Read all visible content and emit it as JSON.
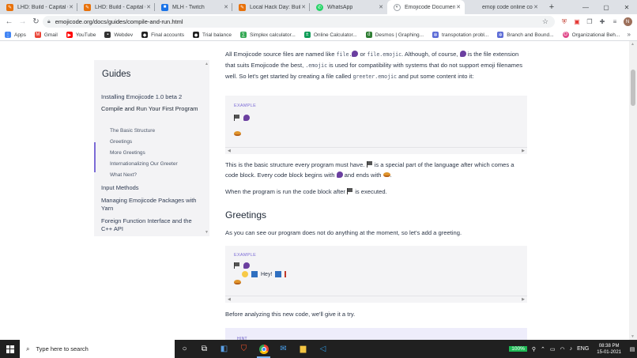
{
  "browser": {
    "tabs": [
      {
        "label": "LHD: Build - Capital One",
        "fav_color": "#e8710a",
        "active": false
      },
      {
        "label": "LHD: Build - Capital One",
        "fav_color": "#e8710a",
        "active": false
      },
      {
        "label": "MLH - Twitch",
        "fav_color": "#1a73e8",
        "active": false
      },
      {
        "label": "Local Hack Day: Build",
        "fav_color": "#e8710a",
        "active": false
      },
      {
        "label": "WhatsApp",
        "fav_color": "#25d366",
        "active": false
      },
      {
        "label": "Emojicode Documentation",
        "fav_color": "#5f6368",
        "active": true
      },
      {
        "label": "emoji code online compiler",
        "fav_color": "#ffffff",
        "active": false
      }
    ],
    "new_tab": "+",
    "window_controls": [
      "—",
      "▢",
      "✕"
    ],
    "url": "emojicode.org/docs/guides/compile-and-run.html",
    "profile_initial": "N"
  },
  "bookmarks": [
    {
      "label": "Apps",
      "color": "#4285f4"
    },
    {
      "label": "Gmail",
      "color": "#ea4335"
    },
    {
      "label": "YouTube",
      "color": "#ff0000"
    },
    {
      "label": "Webdev",
      "color": "#333333"
    },
    {
      "label": "Final accounts",
      "color": "#222222"
    },
    {
      "label": "Trial balance",
      "color": "#222222"
    },
    {
      "label": "Simplex calculator...",
      "color": "#34a853"
    },
    {
      "label": "Online Calculator...",
      "color": "#0f9d58"
    },
    {
      "label": "Desmos | Graphing...",
      "color": "#2e7d32"
    },
    {
      "label": "transpotation probl...",
      "color": "#5b6bd6"
    },
    {
      "label": "Branch and Bound...",
      "color": "#5b6bd6"
    },
    {
      "label": "Organizational Beh...",
      "color": "#e04a8a"
    }
  ],
  "sidebar": {
    "title": "Guides",
    "items": [
      "Installing Emojicode 1.0 beta 2",
      "Compile and Run Your First Program",
      "Input Methods",
      "Managing Emojicode Packages with Yarn",
      "Foreign Function Interface and the C++ API"
    ],
    "subitems": [
      "The Basic Structure",
      "Greetings",
      "More Greetings",
      "Internationalizing Our Greeter",
      "What Next?"
    ]
  },
  "content": {
    "p1": {
      "a": "All Emojicode source files are named like ",
      "code1": "file.",
      "b": " or ",
      "code2": "file.emojic",
      "c": ". Although, of course, ",
      "d": " is the file extension that suits Emojicode the best, ",
      "code3": ".emojic",
      "e": " is used for compatibility with systems that do not support emoji filenames well. So let's get started by creating a file called ",
      "code4": "greeter.emojic",
      "f": " and put some content into it:"
    },
    "example_label": "EXAMPLE",
    "p2": {
      "a": "This is the basic structure every program must have. ",
      "b": " is a special part of the language after which comes a code block. Every code block begins with ",
      "c": " and ends with ",
      "d": "."
    },
    "p3": {
      "a": "When the program is run the code block after ",
      "b": " is executed."
    },
    "heading_greetings": "Greetings",
    "p4": "As you can see our program does not do anything at the moment, so let's add a greeting.",
    "example2_label": "EXAMPLE",
    "greeting_text": "Hey!",
    "p5": "Before analyzing this new code, we'll give it a try.",
    "hint_label": "HINT"
  },
  "taskbar": {
    "search_placeholder": "Type here to search",
    "battery": "100%",
    "language": "ENG",
    "time": "08:38 PM",
    "date": "15-01-2021"
  }
}
